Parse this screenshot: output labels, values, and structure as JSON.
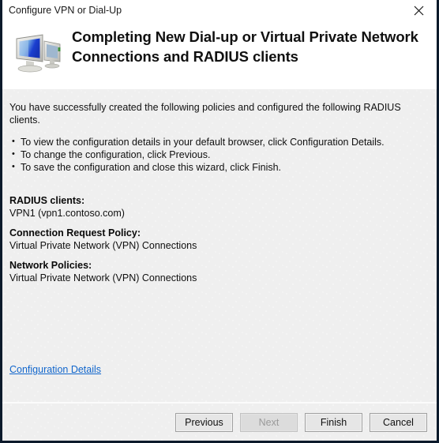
{
  "window": {
    "title": "Configure VPN or Dial-Up",
    "close_icon": "close-icon"
  },
  "header": {
    "icon": "computer-network-icon",
    "heading": "Completing New Dial-up or Virtual Private Network Connections and RADIUS clients"
  },
  "body": {
    "intro": "You have successfully created the following policies and configured the following RADIUS clients.",
    "bullets": [
      "To view the configuration details in your default browser, click Configuration Details.",
      "To change the configuration, click Previous.",
      "To save the configuration and close this wizard, click Finish."
    ],
    "sections": [
      {
        "title": "RADIUS clients:",
        "value": "VPN1 (vpn1.contoso.com)"
      },
      {
        "title": "Connection Request Policy:",
        "value": "Virtual Private Network (VPN) Connections"
      },
      {
        "title": "Network Policies:",
        "value": "Virtual Private Network (VPN) Connections"
      }
    ],
    "details_link": "Configuration Details"
  },
  "footer": {
    "buttons": [
      {
        "label": "Previous",
        "disabled": false
      },
      {
        "label": "Next",
        "disabled": true
      },
      {
        "label": "Finish",
        "disabled": false
      },
      {
        "label": "Cancel",
        "disabled": false
      }
    ]
  },
  "colors": {
    "link": "#1166cc",
    "body_background": "#efefef",
    "header_background": "#ffffff",
    "border": "#0b1a2b",
    "text": "#101010",
    "disabled_text": "#9a9a9a"
  }
}
